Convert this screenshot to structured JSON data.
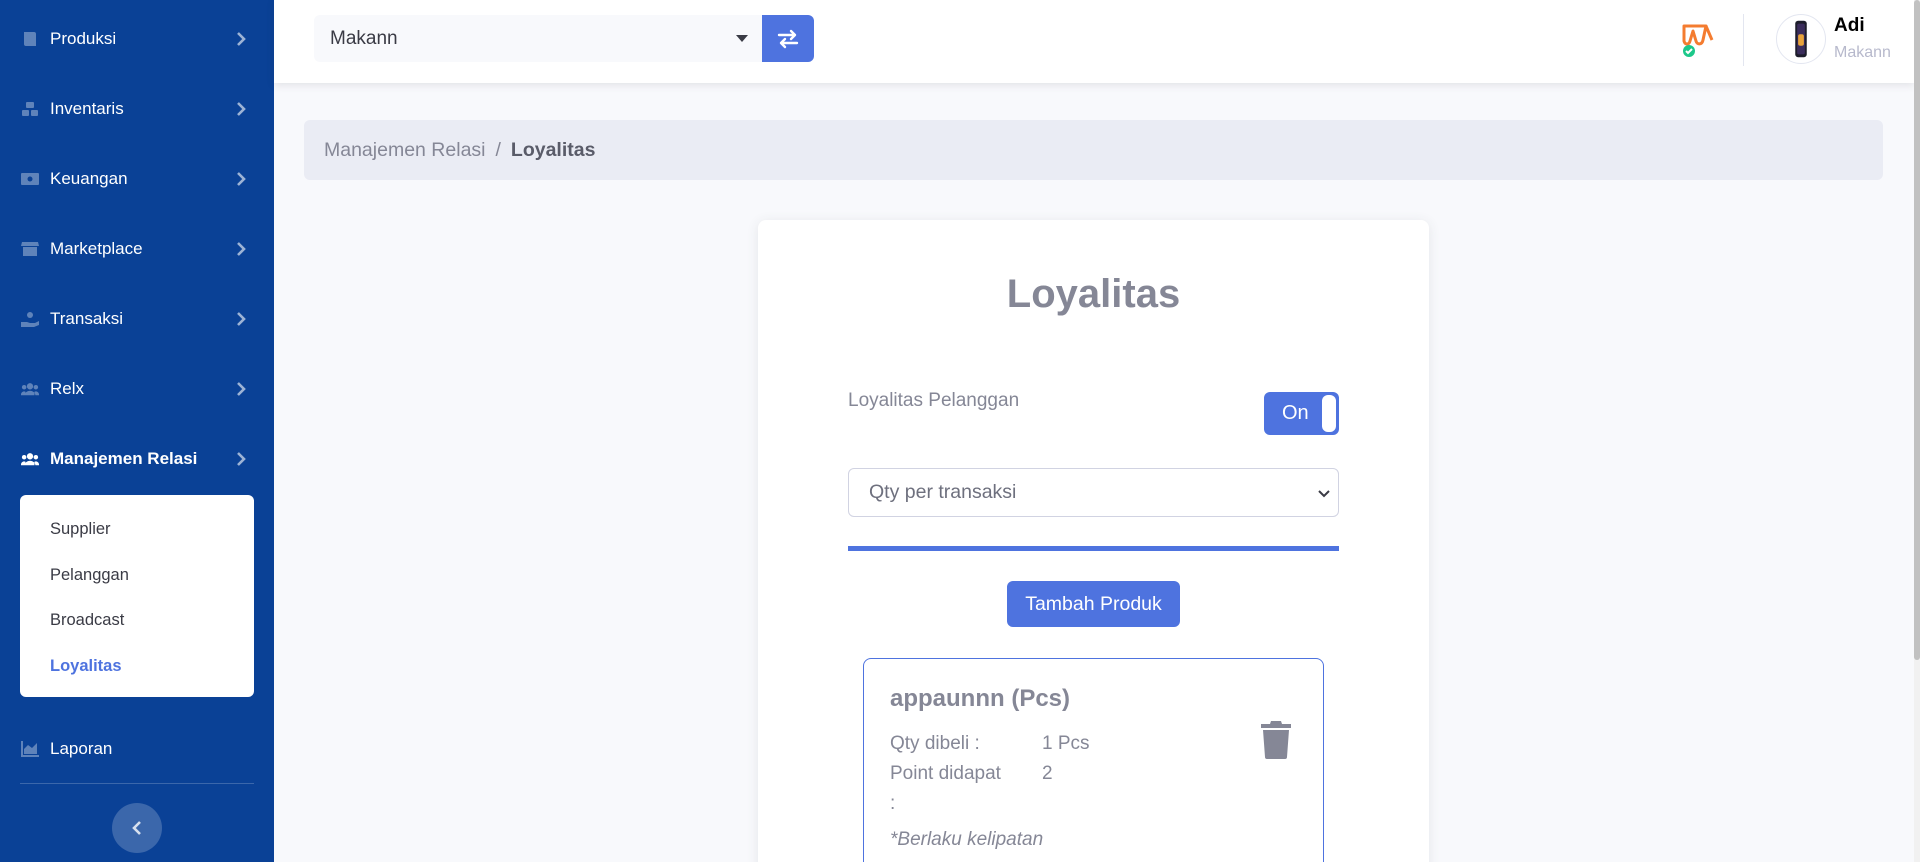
{
  "sidebar": {
    "items": [
      {
        "label": "Produksi",
        "icon": "book-icon"
      },
      {
        "label": "Inventaris",
        "icon": "boxes-icon"
      },
      {
        "label": "Keuangan",
        "icon": "money-bill-icon"
      },
      {
        "label": "Marketplace",
        "icon": "store-icon"
      },
      {
        "label": "Transaksi",
        "icon": "hand-holding-icon"
      },
      {
        "label": "Relx",
        "icon": "users-icon"
      },
      {
        "label": "Manajemen Relasi",
        "icon": "users-icon",
        "active": true
      },
      {
        "label": "Laporan",
        "icon": "chart-area-icon"
      }
    ],
    "submenu": [
      {
        "label": "Supplier"
      },
      {
        "label": "Pelanggan"
      },
      {
        "label": "Broadcast"
      },
      {
        "label": "Loyalitas",
        "active": true
      }
    ]
  },
  "topbar": {
    "store_selected": "Makann",
    "user_name": "Adi",
    "user_store": "Makann"
  },
  "breadcrumb": {
    "parent": "Manajemen Relasi",
    "separator": "/",
    "current": "Loyalitas"
  },
  "card": {
    "title": "Loyalitas",
    "loyalty_label": "Loyalitas Pelanggan",
    "toggle_label": "On",
    "type_selected": "Qty per transaksi",
    "add_button": "Tambah Produk",
    "product": {
      "name": "appaunnn (Pcs)",
      "qty_label": "Qty dibeli :",
      "qty_value": "1 Pcs",
      "point_label": "Point didapat",
      "point_colon": ":",
      "point_value": "2",
      "note": "*Berlaku kelipatan"
    }
  },
  "colors": {
    "sidebar_bg": "#0a4196",
    "primary": "#4e73df",
    "text_muted": "#858796",
    "page_bg": "#f8f9fc"
  }
}
